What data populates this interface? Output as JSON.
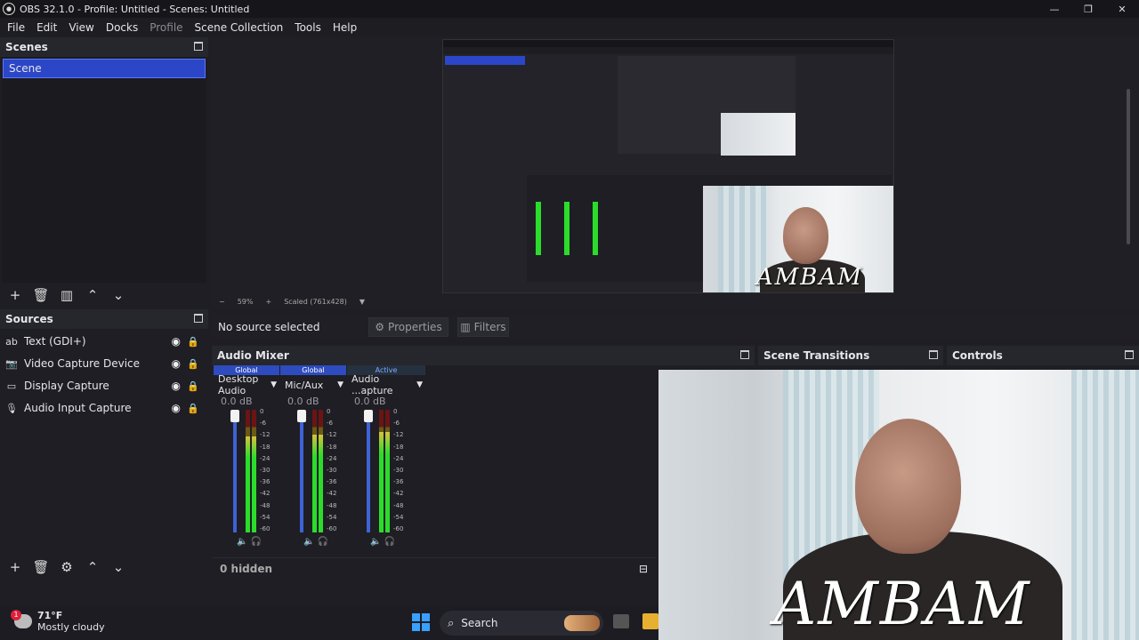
{
  "window": {
    "title": "OBS 32.1.0 - Profile: Untitled - Scenes: Untitled",
    "min": "—",
    "max": "❐",
    "close": "✕"
  },
  "menu": [
    "File",
    "Edit",
    "View",
    "Docks",
    "Profile",
    "Scene Collection",
    "Tools",
    "Help"
  ],
  "scenes": {
    "title": "Scenes",
    "items": [
      "Scene"
    ]
  },
  "sources": {
    "title": "Sources",
    "items": [
      {
        "label": "Text (GDI+)",
        "icon": "text-icon"
      },
      {
        "label": "Video Capture Device",
        "icon": "camera-icon"
      },
      {
        "label": "Display Capture",
        "icon": "monitor-icon"
      },
      {
        "label": "Audio Input Capture",
        "icon": "microphone-icon"
      }
    ]
  },
  "preview": {
    "zoom": "59%",
    "scale": "Scaled (761x428)",
    "minus": "−",
    "plus": "+"
  },
  "context": {
    "no_source": "No source selected",
    "properties": "Properties",
    "filters": "Filters"
  },
  "mixer": {
    "title": "Audio Mixer",
    "channels": [
      {
        "tag": "Global",
        "name": "Desktop Audio",
        "db": "0.0 dB",
        "level": 0.78
      },
      {
        "tag": "Global",
        "name": "Mic/Aux",
        "db": "0.0 dB",
        "level": 0.8
      },
      {
        "tag": "Active",
        "name": "Audio ...apture",
        "db": "0.0 dB",
        "level": 0.82
      }
    ],
    "ticks": [
      "0",
      "-6",
      "-12",
      "-18",
      "-24",
      "-30",
      "-36",
      "-42",
      "-48",
      "-54",
      "-60"
    ],
    "hidden": "0 hidden"
  },
  "transitions": {
    "title": "Scene Transitions"
  },
  "controls": {
    "title": "Controls"
  },
  "webcam": {
    "watermark": "AMBAM"
  },
  "taskbar": {
    "temp": "71°F",
    "condition": "Mostly cloudy",
    "search": "Search",
    "badge": "1"
  },
  "colors": {
    "accent": "#2b46c7",
    "meter_green": "#2bdc2b",
    "background": "#1e1e24"
  }
}
